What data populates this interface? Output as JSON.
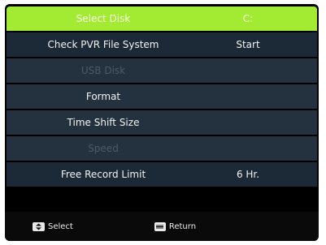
{
  "menu": {
    "items": [
      {
        "label": "Select Disk",
        "value": "C:"
      },
      {
        "label": "Check PVR File System",
        "value": "Start"
      },
      {
        "label": "USB Disk",
        "value": ""
      },
      {
        "label": "Format",
        "value": ""
      },
      {
        "label": "Time Shift Size",
        "value": ""
      },
      {
        "label": "Speed",
        "value": ""
      },
      {
        "label": "Free Record Limit",
        "value": "6 Hr."
      }
    ]
  },
  "footer": {
    "select_label": "Select",
    "return_label": "Return",
    "select_icon": "updown-key-icon",
    "return_icon": "menu-key-icon"
  },
  "colors": {
    "highlight": "#a3ea33",
    "row_dark": "#1b2a36",
    "row_mid": "#23323e"
  }
}
